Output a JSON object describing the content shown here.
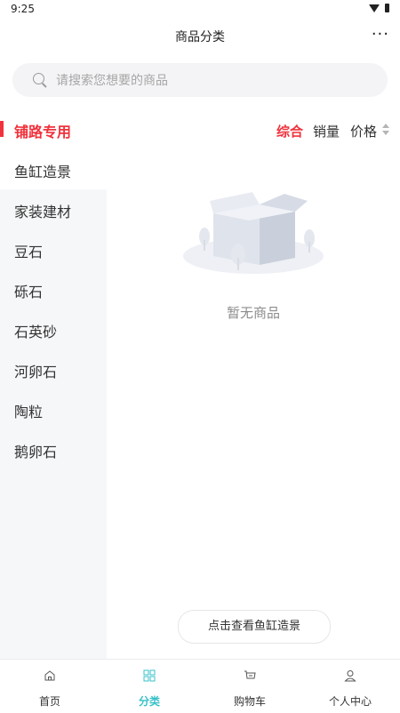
{
  "status_bar": {
    "time": "9:25"
  },
  "header": {
    "title": "商品分类",
    "more_label": "···"
  },
  "search": {
    "placeholder": "请搜索您想要的商品"
  },
  "section": {
    "title": "铺路专用"
  },
  "sort": {
    "options": [
      {
        "label": "综合",
        "active": true
      },
      {
        "label": "销量",
        "active": false
      },
      {
        "label": "价格",
        "active": false
      }
    ]
  },
  "categories": [
    {
      "label": "鱼缸造景",
      "selected": true
    },
    {
      "label": "家装建材",
      "selected": false
    },
    {
      "label": "豆石",
      "selected": false
    },
    {
      "label": "砾石",
      "selected": false
    },
    {
      "label": "石英砂",
      "selected": false
    },
    {
      "label": "河卵石",
      "selected": false
    },
    {
      "label": "陶粒",
      "selected": false
    },
    {
      "label": "鹅卵石",
      "selected": false
    }
  ],
  "empty_state": {
    "message": "暂无商品"
  },
  "view_button": {
    "label": "点击查看鱼缸造景"
  },
  "tabbar": {
    "items": [
      {
        "label": "首页",
        "icon": "home-icon",
        "active": false
      },
      {
        "label": "分类",
        "icon": "grid-icon",
        "active": true
      },
      {
        "label": "购物车",
        "icon": "cart-icon",
        "active": false
      },
      {
        "label": "个人中心",
        "icon": "user-icon",
        "active": false
      }
    ]
  },
  "colors": {
    "accent_red": "#f0323c",
    "tab_active": "#37c0c8",
    "sidebar_bg": "#f6f7f9"
  }
}
